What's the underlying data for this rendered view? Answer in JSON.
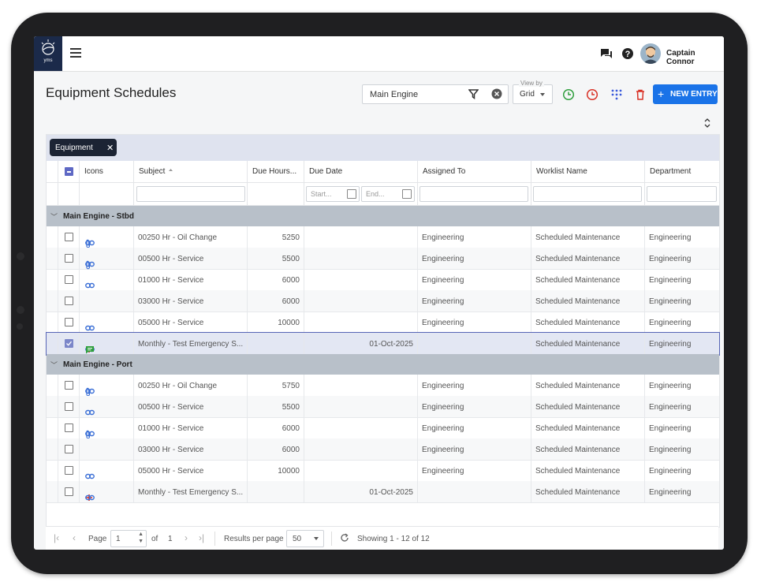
{
  "app": {
    "logo_text": "yms",
    "user_name": "Captain Connor"
  },
  "page": {
    "title": "Equipment Schedules"
  },
  "toolbar": {
    "search_value": "Main Engine",
    "view_by_label": "View by",
    "view_by_value": "Grid",
    "new_entry_label": "NEW ENTRY",
    "icon_colors": {
      "green_clock": "#2e9e3c",
      "red_clock": "#d93025",
      "grid_dots": "#3b5bdb",
      "trash": "#d93025"
    }
  },
  "grouping": {
    "chip_label": "Equipment"
  },
  "columns": [
    "Icons",
    "Subject",
    "Due Hours...",
    "Due Date",
    "Assigned To",
    "Worklist Name",
    "Department"
  ],
  "filters": {
    "start_placeholder": "Start...",
    "end_placeholder": "End..."
  },
  "groups": [
    {
      "name": "Main Engine - Stbd",
      "rows": [
        {
          "icons": [
            "link-icon",
            "paperclip-icon"
          ],
          "subject": "00250 Hr - Oil Change",
          "due_hours": "5250",
          "due_date": "",
          "assigned_to": "Engineering",
          "worklist": "Scheduled Maintenance",
          "department": "Engineering",
          "checked": false
        },
        {
          "icons": [
            "link-icon",
            "paperclip-icon"
          ],
          "subject": "00500 Hr - Service",
          "due_hours": "5500",
          "due_date": "",
          "assigned_to": "Engineering",
          "worklist": "Scheduled Maintenance",
          "department": "Engineering",
          "checked": false
        },
        {
          "icons": [
            "link-icon"
          ],
          "subject": "01000 Hr - Service",
          "due_hours": "6000",
          "due_date": "",
          "assigned_to": "Engineering",
          "worklist": "Scheduled Maintenance",
          "department": "Engineering",
          "checked": false
        },
        {
          "icons": [],
          "subject": "03000 Hr - Service",
          "due_hours": "6000",
          "due_date": "",
          "assigned_to": "Engineering",
          "worklist": "Scheduled Maintenance",
          "department": "Engineering",
          "checked": false
        },
        {
          "icons": [
            "link-icon"
          ],
          "subject": "05000 Hr - Service",
          "due_hours": "10000",
          "due_date": "",
          "assigned_to": "Engineering",
          "worklist": "Scheduled Maintenance",
          "department": "Engineering",
          "checked": false
        },
        {
          "icons": [
            "plus-icon",
            "link-icon",
            "comment-icon"
          ],
          "subject": "Monthly - Test Emergency S...",
          "due_hours": "",
          "due_date": "01-Oct-2025",
          "assigned_to": "",
          "worklist": "Scheduled Maintenance",
          "department": "Engineering",
          "checked": true
        }
      ]
    },
    {
      "name": "Main Engine - Port",
      "rows": [
        {
          "icons": [
            "link-icon",
            "paperclip-icon"
          ],
          "subject": "00250 Hr - Oil Change",
          "due_hours": "5750",
          "due_date": "",
          "assigned_to": "Engineering",
          "worklist": "Scheduled Maintenance",
          "department": "Engineering",
          "checked": false
        },
        {
          "icons": [
            "link-icon"
          ],
          "subject": "00500 Hr - Service",
          "due_hours": "5500",
          "due_date": "",
          "assigned_to": "Engineering",
          "worklist": "Scheduled Maintenance",
          "department": "Engineering",
          "checked": false
        },
        {
          "icons": [
            "link-icon",
            "paperclip-icon"
          ],
          "subject": "01000 Hr - Service",
          "due_hours": "6000",
          "due_date": "",
          "assigned_to": "Engineering",
          "worklist": "Scheduled Maintenance",
          "department": "Engineering",
          "checked": false
        },
        {
          "icons": [],
          "subject": "03000 Hr - Service",
          "due_hours": "6000",
          "due_date": "",
          "assigned_to": "Engineering",
          "worklist": "Scheduled Maintenance",
          "department": "Engineering",
          "checked": false
        },
        {
          "icons": [
            "link-icon"
          ],
          "subject": "05000 Hr - Service",
          "due_hours": "10000",
          "due_date": "",
          "assigned_to": "Engineering",
          "worklist": "Scheduled Maintenance",
          "department": "Engineering",
          "checked": false
        },
        {
          "icons": [
            "plus-icon",
            "link-icon"
          ],
          "subject": "Monthly - Test Emergency S...",
          "due_hours": "",
          "due_date": "01-Oct-2025",
          "assigned_to": "",
          "worklist": "Scheduled Maintenance",
          "department": "Engineering",
          "checked": false
        }
      ]
    }
  ],
  "pagination": {
    "page_label": "Page",
    "page_value": "1",
    "of_label": "of",
    "total_pages": "1",
    "results_label": "Results per page",
    "per_page": "50",
    "showing": "Showing 1 - 12 of 12"
  }
}
